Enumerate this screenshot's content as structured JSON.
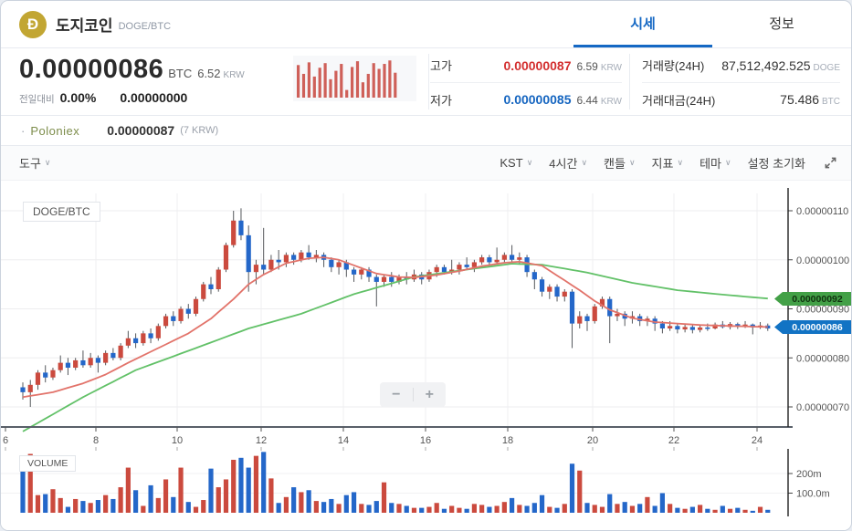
{
  "header": {
    "logo_letter": "Đ",
    "title": "도지코인",
    "pair": "DOGE/BTC",
    "tabs": [
      {
        "label": "시세"
      },
      {
        "label": "정보"
      }
    ]
  },
  "price": {
    "value": "0.00000086",
    "unit": "BTC",
    "krw": "6.52",
    "krw_unit": "KRW",
    "change_label": "전일대비",
    "change_pct": "0.00%",
    "change_abs": "0.00000000"
  },
  "stats": {
    "high_label": "고가",
    "high": "0.00000087",
    "high_krw": "6.59",
    "low_label": "저가",
    "low": "0.00000085",
    "low_krw": "6.44",
    "krw_unit": "KRW",
    "volume_label": "거래량(24H)",
    "volume": "87,512,492.525",
    "volume_unit": "DOGE",
    "value_label": "거래대금(24H)",
    "value": "75.486",
    "value_unit": "BTC"
  },
  "exchange": {
    "bullet": "·",
    "name": "Poloniex",
    "price": "0.00000087",
    "krw": "(7 KRW)"
  },
  "toolbar": {
    "left": [
      {
        "label": "도구",
        "chevron": "∨"
      }
    ],
    "right": [
      {
        "label": "KST",
        "chevron": "∨"
      },
      {
        "label": "4시간",
        "chevron": "∨"
      },
      {
        "label": "캔들",
        "chevron": "∨"
      },
      {
        "label": "지표",
        "chevron": "∨"
      },
      {
        "label": "테마",
        "chevron": "∨"
      },
      {
        "label": "설정 초기화",
        "chevron": ""
      }
    ]
  },
  "chart": {
    "symbol_label": "DOGE/BTC",
    "volume_label": "VOLUME",
    "zoom_out": "−",
    "zoom_in": "+",
    "price_tags": [
      {
        "value": "0.00000092",
        "bg": "#43a047",
        "fg": "#10310f"
      },
      {
        "value": "0.00000086",
        "bg": "#1273c4",
        "fg": "#ffffff"
      }
    ]
  },
  "sparkline": {
    "color": "#c8453c",
    "bars": [
      0.85,
      0.62,
      0.92,
      0.55,
      0.78,
      0.9,
      0.48,
      0.7,
      0.88,
      0.2,
      0.8,
      0.95,
      0.4,
      0.62,
      0.9,
      0.75,
      0.88,
      0.97,
      0.65
    ]
  },
  "chart_data": {
    "type": "candlestick+volume",
    "title": "DOGE/BTC 4시간 캔들",
    "up_color": "#cb4a3e",
    "down_color": "#2467c9",
    "wick_color": "#55585c",
    "ma_short_color": "#e2736a",
    "ma_long_color": "#62c168",
    "y_axis": {
      "labels": [
        "0.00000110",
        "0.00000100",
        "0.00000090",
        "0.00000080",
        "0.00000070"
      ],
      "values": [
        110,
        100,
        90,
        80,
        70
      ],
      "unit": "BTC x 1e-8"
    },
    "x_axis": {
      "labels": [
        "6",
        "8",
        "10",
        "12",
        "14",
        "16",
        "18",
        "20",
        "22",
        "24"
      ]
    },
    "volume_axis": {
      "labels": [
        "200m",
        "100.0m"
      ],
      "values": [
        200,
        100
      ]
    },
    "current_price": 86,
    "candles": [
      [
        74,
        75,
        71.5,
        73
      ],
      [
        73,
        75.5,
        70,
        74.5
      ],
      [
        74.5,
        77.5,
        73.5,
        77
      ],
      [
        77,
        78.5,
        75,
        76
      ],
      [
        76,
        78,
        75.5,
        77.5
      ],
      [
        77.5,
        80.5,
        77,
        79
      ],
      [
        79,
        80,
        76.5,
        78
      ],
      [
        78,
        80,
        77.5,
        79.5
      ],
      [
        79.5,
        81.5,
        78,
        78.5
      ],
      [
        78.5,
        81,
        78,
        80
      ],
      [
        80,
        80.5,
        77,
        79
      ],
      [
        79,
        81.5,
        78.5,
        81
      ],
      [
        81,
        82,
        79.5,
        80
      ],
      [
        80,
        83,
        79.5,
        82.5
      ],
      [
        82.5,
        85.5,
        82,
        84
      ],
      [
        84,
        85,
        82,
        83
      ],
      [
        83,
        85.5,
        82.5,
        85
      ],
      [
        85,
        86,
        83,
        84
      ],
      [
        84,
        87,
        83.5,
        86.5
      ],
      [
        86.5,
        89,
        86,
        88.5
      ],
      [
        88.5,
        89.5,
        86.5,
        87.5
      ],
      [
        87.5,
        90.5,
        87,
        90
      ],
      [
        90,
        91,
        88,
        89
      ],
      [
        89,
        92.5,
        88.5,
        92
      ],
      [
        92,
        95.5,
        91.5,
        95
      ],
      [
        95,
        96.5,
        93,
        94
      ],
      [
        94,
        98.5,
        93.5,
        98
      ],
      [
        98,
        103.5,
        97.5,
        103
      ],
      [
        103,
        110,
        102.5,
        108
      ],
      [
        108,
        110.5,
        104,
        105
      ],
      [
        105,
        107,
        93.5,
        97.5
      ],
      [
        97.5,
        100,
        95,
        99
      ],
      [
        99,
        106.5,
        97,
        98
      ],
      [
        98,
        101,
        97.5,
        100
      ],
      [
        100,
        102,
        98,
        99.5
      ],
      [
        99.5,
        101.5,
        98.5,
        101
      ],
      [
        101,
        101.5,
        99,
        100
      ],
      [
        100,
        102,
        99.5,
        101.5
      ],
      [
        101.5,
        103,
        100,
        100.5
      ],
      [
        100.5,
        102,
        99.5,
        101
      ],
      [
        101,
        101.5,
        98.5,
        100
      ],
      [
        100,
        100.5,
        97.5,
        98.5
      ],
      [
        98.5,
        100,
        97,
        99.5
      ],
      [
        99.5,
        100,
        96.5,
        98
      ],
      [
        98,
        98.5,
        95.5,
        97
      ],
      [
        97,
        98.5,
        96,
        98
      ],
      [
        98,
        98.5,
        95.5,
        96.5
      ],
      [
        96.5,
        97,
        90.5,
        95.5
      ],
      [
        95.5,
        97,
        94.5,
        96.5
      ],
      [
        96.5,
        97.5,
        94.5,
        95.5
      ],
      [
        95.5,
        97,
        95,
        96.5
      ],
      [
        96.5,
        97.5,
        95,
        96
      ],
      [
        96,
        98,
        95.5,
        97
      ],
      [
        97,
        97.5,
        95,
        96
      ],
      [
        96,
        98,
        95.5,
        97.5
      ],
      [
        97.5,
        99,
        96.5,
        98.5
      ],
      [
        98.5,
        99,
        97,
        97.5
      ],
      [
        97.5,
        100,
        97,
        98
      ],
      [
        98,
        99.5,
        97,
        99
      ],
      [
        99,
        100.5,
        98,
        98.5
      ],
      [
        98.5,
        100,
        97.5,
        99.5
      ],
      [
        99.5,
        101,
        99,
        100.5
      ],
      [
        100.5,
        101,
        98.5,
        99.5
      ],
      [
        99.5,
        102.5,
        99,
        100
      ],
      [
        100,
        101.5,
        99.5,
        101
      ],
      [
        101,
        103,
        99.5,
        100
      ],
      [
        100,
        101.5,
        99,
        100.5
      ],
      [
        100.5,
        101,
        96.5,
        97.5
      ],
      [
        97.5,
        98,
        94,
        96
      ],
      [
        96,
        96.5,
        92.5,
        93.5
      ],
      [
        93.5,
        95,
        92,
        94.5
      ],
      [
        94.5,
        95,
        91.5,
        92.5
      ],
      [
        92.5,
        94,
        91.5,
        93.5
      ],
      [
        93.5,
        94,
        82,
        87
      ],
      [
        87,
        89.5,
        86,
        88.5
      ],
      [
        88.5,
        89,
        85.5,
        87.5
      ],
      [
        87.5,
        91,
        87,
        90.5
      ],
      [
        90.5,
        92.5,
        90,
        92
      ],
      [
        92,
        92.5,
        83,
        88.5
      ],
      [
        88.5,
        90,
        87.5,
        89
      ],
      [
        89,
        89.5,
        86.5,
        88
      ],
      [
        88,
        89.5,
        87,
        88.5
      ],
      [
        88.5,
        89,
        86.5,
        87.5
      ],
      [
        87.5,
        88.5,
        86.5,
        88
      ],
      [
        88,
        88.5,
        85.5,
        87
      ],
      [
        87,
        87.5,
        85,
        86
      ],
      [
        86,
        87.5,
        85.5,
        86.5
      ],
      [
        86.5,
        87,
        85,
        85.8
      ],
      [
        85.8,
        87,
        85.2,
        86.3
      ],
      [
        86.3,
        86.8,
        85,
        85.7
      ],
      [
        85.7,
        86.6,
        85.2,
        86.2
      ],
      [
        86.2,
        87,
        85.5,
        86
      ],
      [
        86,
        87.2,
        85.8,
        86.8
      ],
      [
        86.8,
        87.5,
        86,
        86.3
      ],
      [
        86.3,
        87.3,
        85.8,
        86.9
      ],
      [
        86.9,
        87.2,
        85.9,
        86.4
      ],
      [
        86.4,
        87.5,
        86.1,
        86.8
      ],
      [
        86.8,
        87,
        84.8,
        86.2
      ],
      [
        86.2,
        87.3,
        85.9,
        86.6
      ],
      [
        86.6,
        87,
        85.5,
        86
      ]
    ],
    "volumes": [
      250,
      300,
      90,
      95,
      120,
      75,
      30,
      70,
      60,
      50,
      65,
      90,
      70,
      130,
      230,
      115,
      35,
      140,
      75,
      170,
      80,
      230,
      55,
      30,
      65,
      225,
      130,
      170,
      270,
      280,
      230,
      290,
      310,
      175,
      50,
      80,
      130,
      105,
      115,
      60,
      55,
      70,
      45,
      90,
      105,
      45,
      40,
      60,
      155,
      50,
      45,
      35,
      25,
      25,
      30,
      50,
      20,
      35,
      25,
      20,
      45,
      40,
      30,
      35,
      55,
      75,
      40,
      35,
      50,
      90,
      30,
      25,
      45,
      250,
      215,
      50,
      40,
      30,
      95,
      45,
      55,
      35,
      45,
      80,
      35,
      100,
      45,
      25,
      20,
      30,
      40,
      20,
      15,
      35,
      20,
      25,
      15,
      10,
      30,
      15
    ],
    "ma_short": [
      [
        0,
        72
      ],
      [
        4,
        73
      ],
      [
        8,
        74.8
      ],
      [
        11,
        76.6
      ],
      [
        14,
        79
      ],
      [
        18,
        82
      ],
      [
        22,
        85
      ],
      [
        25,
        88
      ],
      [
        28,
        92
      ],
      [
        30,
        95
      ],
      [
        32,
        97
      ],
      [
        35,
        99.3
      ],
      [
        38,
        100.3
      ],
      [
        40,
        100.5
      ],
      [
        42,
        100
      ],
      [
        45,
        98.3
      ],
      [
        47,
        97.2
      ],
      [
        50,
        96.5
      ],
      [
        52,
        96.4
      ],
      [
        55,
        96.9
      ],
      [
        58,
        97.7
      ],
      [
        61,
        98.7
      ],
      [
        64,
        99.4
      ],
      [
        66,
        99.6
      ],
      [
        69,
        98.8
      ],
      [
        71,
        96.8
      ],
      [
        74,
        93.8
      ],
      [
        76,
        91.6
      ],
      [
        78,
        89.8
      ],
      [
        81,
        88.1
      ],
      [
        84,
        87.3
      ],
      [
        87,
        87
      ],
      [
        90,
        86.7
      ],
      [
        94,
        86.5
      ],
      [
        99,
        86.3
      ]
    ],
    "ma_long": [
      [
        0,
        65
      ],
      [
        8,
        72
      ],
      [
        15,
        77.5
      ],
      [
        23,
        82
      ],
      [
        30,
        86
      ],
      [
        37,
        89
      ],
      [
        44,
        93
      ],
      [
        52,
        96.5
      ],
      [
        59,
        98
      ],
      [
        65,
        99.2
      ],
      [
        69,
        99
      ],
      [
        75,
        97.4
      ],
      [
        81,
        95.3
      ],
      [
        87,
        93.8
      ],
      [
        93,
        92.9
      ],
      [
        99,
        92.1
      ]
    ]
  }
}
